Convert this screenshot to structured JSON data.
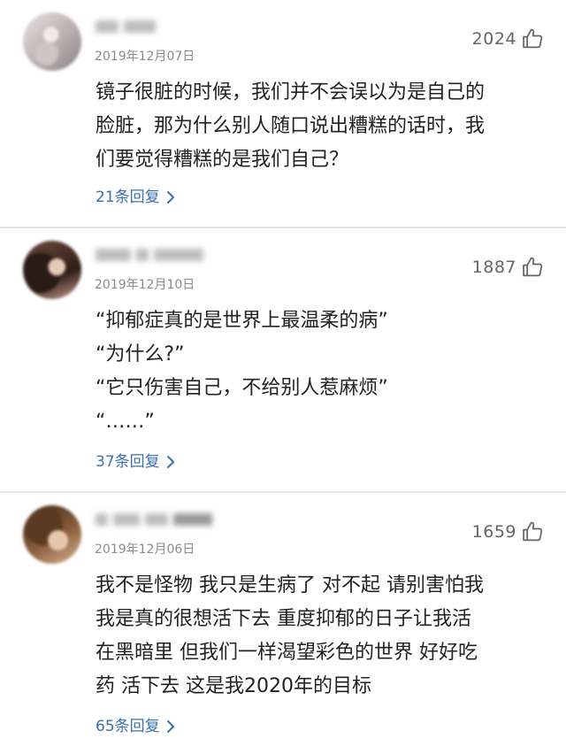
{
  "comments": [
    {
      "username": "用户名",
      "date": "2019年12月07日",
      "likes": "2024",
      "lines": [
        "镜子很脏的时候，我们并不会误以为是自己的",
        "脸脏，那为什么别人随口说出糟糕的话时，我",
        "们要觉得糟糕的是我们自己？"
      ],
      "replies": "21条回复"
    },
    {
      "username": "用户名称",
      "date": "2019年12月10日",
      "likes": "1887",
      "lines": [
        "“抑郁症真的是世界上最温柔的病”",
        "“为什么?”",
        "“它只伤害自己，不给别人惹麻烦”",
        "“……”"
      ],
      "replies": "37条回复"
    },
    {
      "username": "用户名称",
      "date": "2019年12月06日",
      "likes": "1659",
      "lines": [
        "我不是怪物 我只是生病了 对不起 请别害怕我",
        "我是真的很想活下去 重度抑郁的日子让我活",
        "在黑暗里 但我们一样渴望彩色的世界 好好吃",
        "药 活下去 这是我2020年的目标"
      ],
      "replies": "65条回复"
    }
  ],
  "icons": {
    "like": "thumbs-up-icon",
    "chevron": "chevron-right-icon",
    "avatar": "avatar"
  },
  "colors": {
    "reply_link": "#3b6fae",
    "date": "#8c8c8c",
    "body": "#222222",
    "likes": "#666666"
  }
}
